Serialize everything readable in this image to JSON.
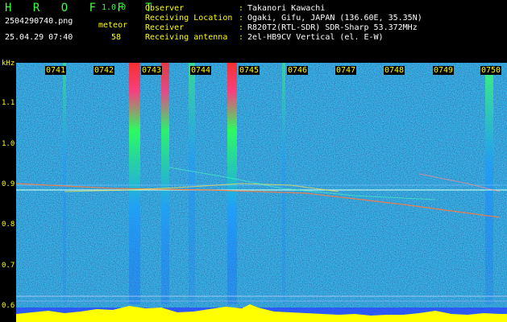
{
  "header": {
    "app_name": "H R O F F T",
    "app_version": "1.0.0",
    "filename": "2504290740.png",
    "detection_label": "meteor",
    "datetime": "25.04.29 07:40",
    "meteor_count": "58",
    "observer_label": "Observer",
    "observer_value": "Takanori Kawachi",
    "location_label": "Receiving Location",
    "location_value": "Ogaki, Gifu, JAPAN (136.60E, 35.35N)",
    "receiver_label": "Receiver",
    "receiver_value": "R820T2(RTL-SDR) SDR-Sharp 53.372MHz",
    "antenna_label": "Receiving antenna",
    "antenna_value": "2el-HB9CV Vertical (el. E-W)"
  },
  "axes": {
    "y_unit": "kHz",
    "y_ticks": [
      "1.1",
      "1.0",
      "0.9",
      "0.8",
      "0.7",
      "0.6"
    ],
    "x_ticks": [
      "0741",
      "0742",
      "0743",
      "0744",
      "0745",
      "0746",
      "0747",
      "0748",
      "0749",
      "0750"
    ]
  },
  "colors": {
    "background": "#06124a",
    "text_yellow": "#ffff00",
    "text_green": "#3cff3c",
    "text_white": "#ffffff"
  }
}
